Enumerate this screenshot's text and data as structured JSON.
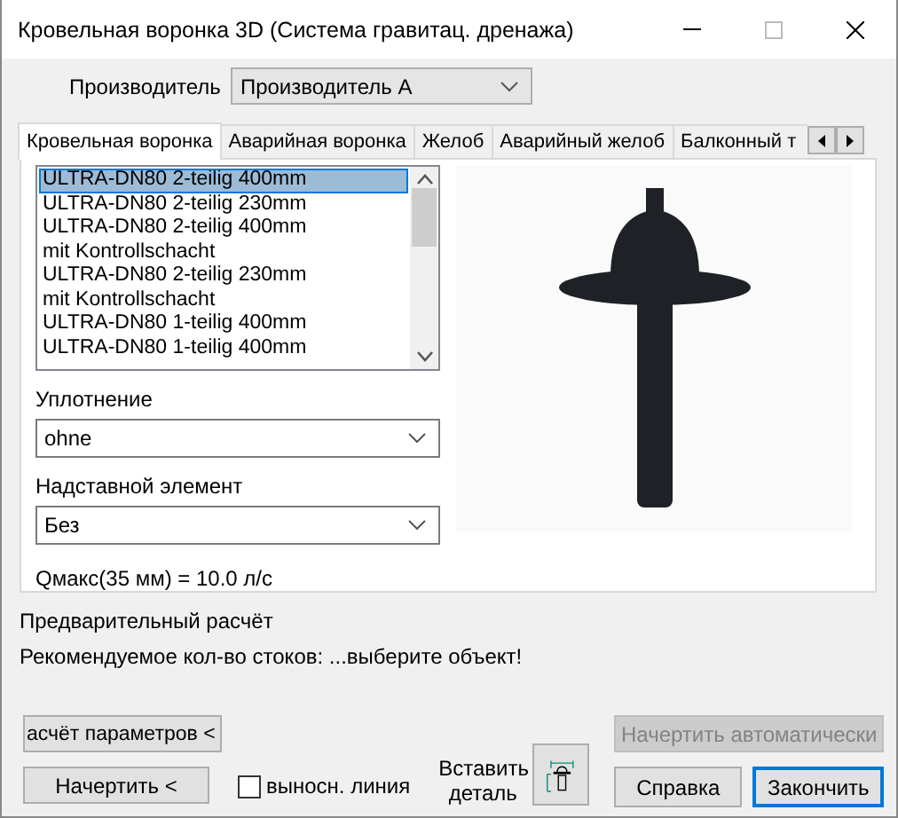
{
  "window": {
    "title": "Кровельная воронка 3D (Система гравитац. дренажа)"
  },
  "manufacturer": {
    "label": "Производитель",
    "value": "Производитель А"
  },
  "tabs": [
    {
      "label": "Кровельная воронка",
      "selected": true
    },
    {
      "label": "Аварийная воронка",
      "selected": false
    },
    {
      "label": "Желоб",
      "selected": false
    },
    {
      "label": "Аварийный желоб",
      "selected": false
    },
    {
      "label": "Балконный т",
      "selected": false
    }
  ],
  "product_list": [
    {
      "lines": [
        "ULTRA-DN80 2-teilig 400mm"
      ],
      "selected": true
    },
    {
      "lines": [
        "ULTRA-DN80 2-teilig 230mm"
      ],
      "selected": false
    },
    {
      "lines": [
        "ULTRA-DN80 2-teilig 400mm",
        "mit Kontrollschacht"
      ],
      "selected": false
    },
    {
      "lines": [
        "ULTRA-DN80 2-teilig 230mm",
        "mit Kontrollschacht"
      ],
      "selected": false
    },
    {
      "lines": [
        "ULTRA-DN80 1-teilig 400mm"
      ],
      "selected": false
    },
    {
      "lines": [
        "ULTRA-DN80 1-teilig 400mm"
      ],
      "selected": false
    }
  ],
  "seal": {
    "label": "Уплотнение",
    "value": "ohne"
  },
  "extension": {
    "label": "Надставной элемент",
    "value": "Без"
  },
  "flow": "Qмакс(35 мм) = 10.0 л/с",
  "preliminary": {
    "title": "Предварительный расчёт",
    "recommendation": "Рекомендуемое кол-во стоков: ...выберите объект!"
  },
  "calc_button": {
    "label": "асчёт параметров <"
  },
  "draw_button": {
    "label": "Начертить <"
  },
  "leader_line": {
    "label": "выносн. линия",
    "checked": false
  },
  "insert_detail": {
    "label": "Вставить деталь"
  },
  "auto_button": {
    "label": "Начертить автоматически",
    "disabled": true
  },
  "help_button": {
    "label": "Справка",
    "default": false
  },
  "finish_button": {
    "label": "Закончить",
    "default": true
  }
}
